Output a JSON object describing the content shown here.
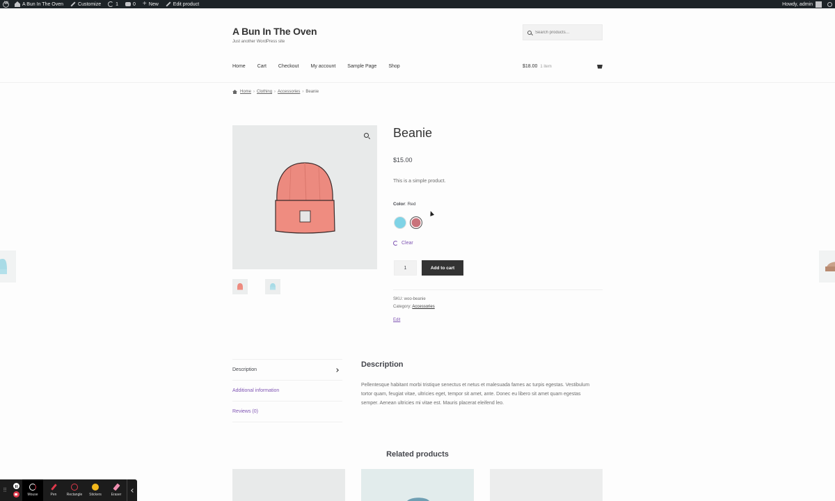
{
  "admin_bar": {
    "site_name": "A Bun In The Oven",
    "customize": "Customize",
    "updates_count": "1",
    "comments_count": "0",
    "new_label": "New",
    "edit_label": "Edit product",
    "howdy": "Howdy, admin"
  },
  "header": {
    "site_title": "A Bun In The Oven",
    "tagline": "Just another WordPress site",
    "search_placeholder": "Search products…",
    "nav": [
      "Home",
      "Cart",
      "Checkout",
      "My account",
      "Sample Page",
      "Shop"
    ],
    "cart_amount": "$18.00",
    "cart_count": "1 item"
  },
  "breadcrumb": {
    "items": [
      "Home",
      "Clothing",
      "Accessories"
    ],
    "current": "Beanie"
  },
  "product": {
    "title": "Beanie",
    "price": "$15.00",
    "short_description": "This is a simple product.",
    "color_label": "Color",
    "color_value": ": Red",
    "swatches": [
      {
        "name": "Blue",
        "color": "#7fd3e6"
      },
      {
        "name": "Red",
        "color": "#c9737b"
      }
    ],
    "clear_label": "Clear",
    "quantity": "1",
    "add_to_cart": "Add to cart",
    "sku_label": "SKU: woo-beanie",
    "category_label": "Category: ",
    "category_value": "Accessories",
    "edit_link": "Edit"
  },
  "tabs": {
    "items": [
      "Description",
      "Additional information",
      "Reviews (0)"
    ],
    "panel_title": "Description",
    "panel_text": "Pellentesque habitant morbi tristique senectus et netus et malesuada fames ac turpis egestas. Vestibulum tortor quam, feugiat vitae, ultricies eget, tempor sit amet, ante. Donec eu libero sit amet quam egestas semper. Aenean ultricies mi vitae est. Mauris placerat eleifend leo."
  },
  "related": {
    "title": "Related products"
  },
  "recording_toolbar": {
    "tools": [
      "Mouse",
      "Pen",
      "Rectangle",
      "Stickers",
      "Eraser"
    ]
  },
  "colors": {
    "accent": "#7f54b3",
    "button": "#333333",
    "admin_bar": "#1d2327"
  }
}
